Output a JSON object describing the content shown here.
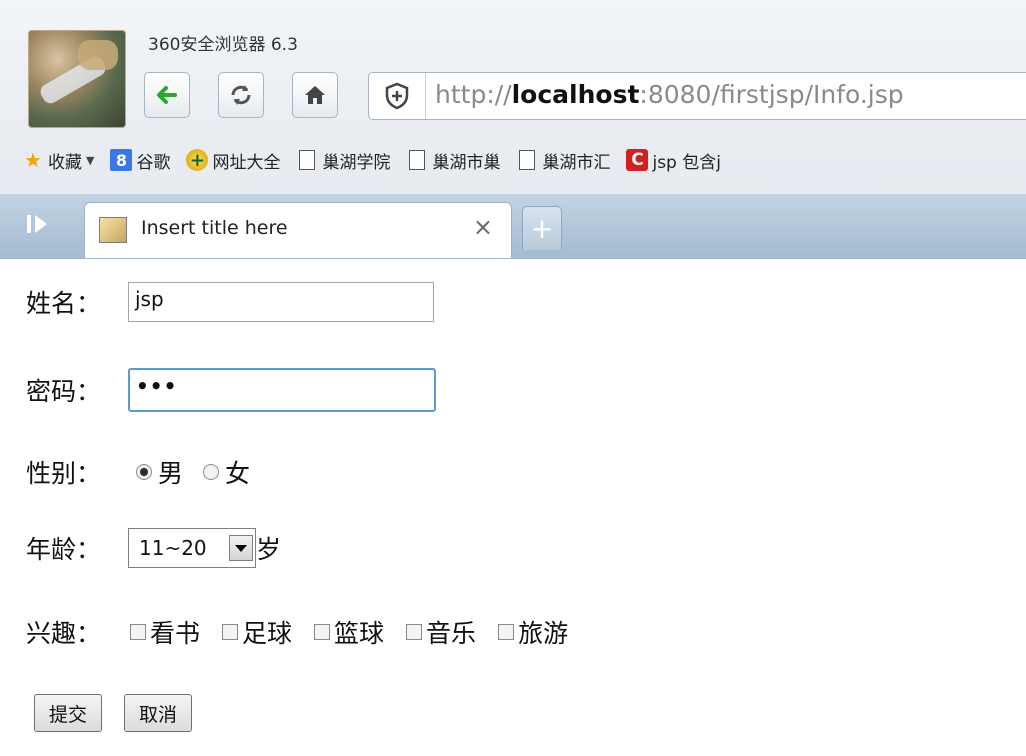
{
  "window": {
    "title": "360安全浏览器 6.3"
  },
  "address_bar": {
    "protocol": "http://",
    "host": "localhost",
    "rest": ":8080/firstjsp/Info.jsp"
  },
  "bookmarks": [
    {
      "label": "收藏",
      "icon": "star-icon"
    },
    {
      "label": "谷歌",
      "icon": "google-8-icon"
    },
    {
      "label": "网址大全",
      "icon": "plus-circle-icon"
    },
    {
      "label": "巢湖学院",
      "icon": "document-icon"
    },
    {
      "label": "巢湖市巢",
      "icon": "document-icon"
    },
    {
      "label": "巢湖市汇",
      "icon": "document-icon"
    },
    {
      "label": "jsp 包含j",
      "icon": "c-logo-icon"
    }
  ],
  "tab": {
    "title": "Insert title here",
    "close": "×",
    "new_tab": "+"
  },
  "form": {
    "name_label": "姓名：",
    "name_value": "jsp",
    "password_label": "密码：",
    "password_value": "•••",
    "gender_label": "性别：",
    "gender_options": [
      "男",
      "女"
    ],
    "gender_selected": "男",
    "age_label": "年龄：",
    "age_value": "11~20",
    "age_unit": "岁",
    "hobby_label": "兴趣：",
    "hobbies": [
      "看书",
      "足球",
      "篮球",
      "音乐",
      "旅游"
    ],
    "submit": "提交",
    "cancel": "取消"
  }
}
